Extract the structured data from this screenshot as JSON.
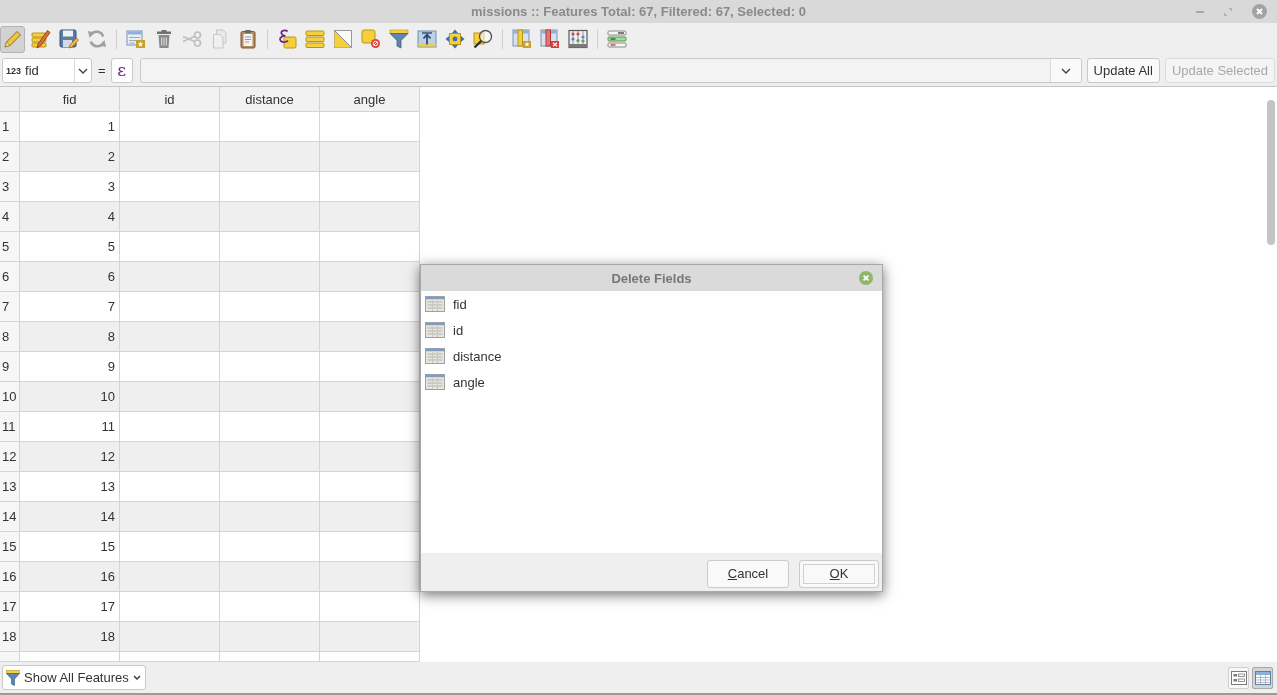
{
  "window": {
    "title": "missions :: Features Total: 67, Filtered: 67, Selected: 0"
  },
  "toolbar": [
    {
      "buttons": [
        {
          "kind": "edit",
          "selected": true,
          "disabled": false
        },
        {
          "kind": "multiedit",
          "selected": false,
          "disabled": false
        },
        {
          "kind": "save",
          "selected": false,
          "disabled": false
        },
        {
          "kind": "reload",
          "selected": false,
          "disabled": false
        }
      ]
    },
    {
      "buttons": [
        {
          "kind": "add",
          "selected": false,
          "disabled": false
        },
        {
          "kind": "delete",
          "selected": false,
          "disabled": false
        },
        {
          "kind": "cut",
          "selected": false,
          "disabled": true
        },
        {
          "kind": "copy",
          "selected": false,
          "disabled": true
        },
        {
          "kind": "paste",
          "selected": false,
          "disabled": false
        }
      ]
    },
    {
      "buttons": [
        {
          "kind": "expression",
          "selected": false,
          "disabled": false
        },
        {
          "kind": "selectall",
          "selected": false,
          "disabled": false
        },
        {
          "kind": "invert",
          "selected": false,
          "disabled": false
        },
        {
          "kind": "deselect",
          "selected": false,
          "disabled": false
        },
        {
          "kind": "filter",
          "selected": false,
          "disabled": false
        },
        {
          "kind": "totop",
          "selected": false,
          "disabled": false
        },
        {
          "kind": "pan",
          "selected": false,
          "disabled": false
        },
        {
          "kind": "zoom",
          "selected": false,
          "disabled": false
        }
      ]
    },
    {
      "buttons": [
        {
          "kind": "newfield",
          "selected": false,
          "disabled": false
        },
        {
          "kind": "deletefield",
          "selected": false,
          "disabled": false
        },
        {
          "kind": "calculator",
          "selected": false,
          "disabled": false
        }
      ]
    },
    {
      "buttons": [
        {
          "kind": "formatting",
          "selected": false,
          "disabled": false
        }
      ]
    }
  ],
  "expression_bar": {
    "field": {
      "type": "123",
      "value": "fid"
    },
    "operator": "=",
    "expression_button": "ε",
    "buttons": [
      {
        "label": "Update All",
        "disabled": false
      },
      {
        "label": "Update Selected",
        "disabled": true
      }
    ]
  },
  "table": {
    "columns": [
      "fid",
      "id",
      "distance",
      "angle"
    ],
    "rows": [
      {
        "header": "1",
        "cells": [
          "1"
        ]
      },
      {
        "header": "2",
        "cells": [
          "2"
        ]
      },
      {
        "header": "3",
        "cells": [
          "3"
        ]
      },
      {
        "header": "4",
        "cells": [
          "4"
        ]
      },
      {
        "header": "5",
        "cells": [
          "5"
        ]
      },
      {
        "header": "6",
        "cells": [
          "6"
        ]
      },
      {
        "header": "7",
        "cells": [
          "7"
        ]
      },
      {
        "header": "8",
        "cells": [
          "8"
        ]
      },
      {
        "header": "9",
        "cells": [
          "9"
        ]
      },
      {
        "header": "10",
        "cells": [
          "10"
        ]
      },
      {
        "header": "11",
        "cells": [
          "11"
        ]
      },
      {
        "header": "12",
        "cells": [
          "12"
        ]
      },
      {
        "header": "13",
        "cells": [
          "13"
        ]
      },
      {
        "header": "14",
        "cells": [
          "14"
        ]
      },
      {
        "header": "15",
        "cells": [
          "15"
        ]
      },
      {
        "header": "16",
        "cells": [
          "16"
        ]
      },
      {
        "header": "17",
        "cells": [
          "17"
        ]
      },
      {
        "header": "18",
        "cells": [
          "18"
        ]
      }
    ]
  },
  "dialog": {
    "title": "Delete Fields",
    "fields": [
      {
        "name": "fid",
        "selected": false
      },
      {
        "name": "id",
        "selected": false
      },
      {
        "name": "distance",
        "selected": false
      },
      {
        "name": "angle",
        "selected": false
      }
    ],
    "buttons": [
      {
        "label": "Cancel",
        "default": false
      },
      {
        "label": "OK",
        "default": true
      }
    ]
  },
  "footer": {
    "filter_button": "Show All Features",
    "view_buttons": [
      {
        "kind": "form",
        "selected": false
      },
      {
        "kind": "table",
        "selected": true
      }
    ]
  }
}
